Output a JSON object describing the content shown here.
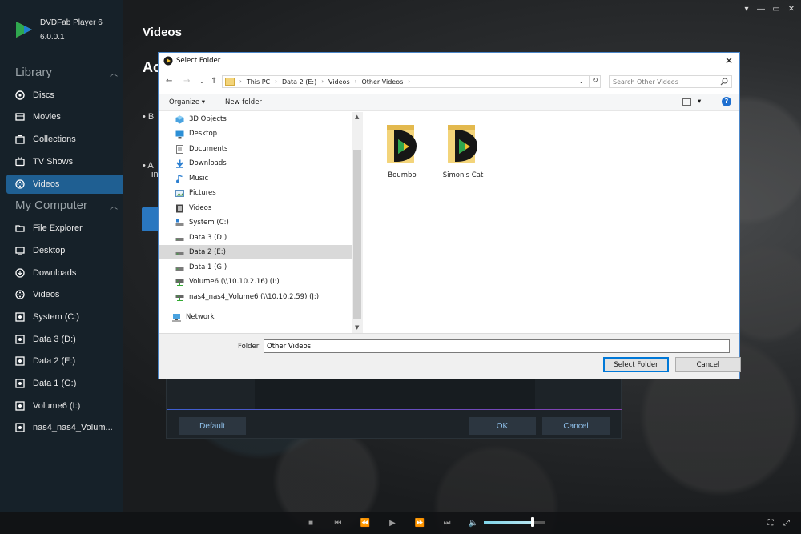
{
  "app": {
    "name": "DVDFab Player 6",
    "version": "6.0.0.1"
  },
  "sidebar": {
    "library_title": "Library",
    "library_items": [
      {
        "label": "Discs",
        "icon": "disc-icon"
      },
      {
        "label": "Movies",
        "icon": "film-icon"
      },
      {
        "label": "Collections",
        "icon": "collection-icon"
      },
      {
        "label": "TV Shows",
        "icon": "tv-icon"
      },
      {
        "label": "Videos",
        "icon": "video-reel-icon",
        "active": true
      }
    ],
    "computer_title": "My Computer",
    "computer_items": [
      {
        "label": "File Explorer",
        "icon": "folder-icon"
      },
      {
        "label": "Desktop",
        "icon": "monitor-icon"
      },
      {
        "label": "Downloads",
        "icon": "download-icon"
      },
      {
        "label": "Videos",
        "icon": "video-reel-icon"
      },
      {
        "label": "System (C:)",
        "icon": "drive-icon"
      },
      {
        "label": "Data 3 (D:)",
        "icon": "drive-icon"
      },
      {
        "label": "Data 2 (E:)",
        "icon": "drive-icon"
      },
      {
        "label": "Data 1 (G:)",
        "icon": "drive-icon"
      },
      {
        "label": "Volume6 (I:)",
        "icon": "drive-icon"
      },
      {
        "label": "nas4_nas4_Volum...",
        "icon": "drive-icon"
      }
    ]
  },
  "main": {
    "title": "Videos",
    "subtitle_partial": "Ac",
    "bullet1_partial": "B",
    "bullet2_line1_partial": "A",
    "bullet2_line2_partial": "in"
  },
  "settings_panel": {
    "default_label": "Default",
    "ok_label": "OK",
    "cancel_label": "Cancel"
  },
  "dialog": {
    "title": "Select Folder",
    "breadcrumb": [
      "This PC",
      "Data 2 (E:)",
      "Videos",
      "Other Videos"
    ],
    "search_placeholder": "Search Other Videos",
    "toolbar": {
      "organize": "Organize",
      "new_folder": "New folder"
    },
    "tree": [
      {
        "label": "3D Objects",
        "icon": "cube-icon"
      },
      {
        "label": "Desktop",
        "icon": "desktop-icon"
      },
      {
        "label": "Documents",
        "icon": "document-icon"
      },
      {
        "label": "Downloads",
        "icon": "download-arrow-icon"
      },
      {
        "label": "Music",
        "icon": "music-note-icon"
      },
      {
        "label": "Pictures",
        "icon": "picture-icon"
      },
      {
        "label": "Videos",
        "icon": "film-strip-icon"
      },
      {
        "label": "System (C:)",
        "icon": "system-drive-icon"
      },
      {
        "label": "Data 3 (D:)",
        "icon": "drive-icon"
      },
      {
        "label": "Data 2 (E:)",
        "icon": "drive-icon",
        "selected": true
      },
      {
        "label": "Data 1 (G:)",
        "icon": "drive-icon"
      },
      {
        "label": "Volume6 (\\\\10.10.2.16) (I:)",
        "icon": "network-drive-icon"
      },
      {
        "label": "nas4_nas4_Volume6 (\\\\10.10.2.59) (J:)",
        "icon": "network-drive-icon"
      }
    ],
    "network_label": "Network",
    "files": [
      {
        "name": "Boumbo",
        "icon": "dvdfab-folder-icon"
      },
      {
        "name": "Simon's Cat",
        "icon": "dvdfab-folder-icon"
      }
    ],
    "folder_label": "Folder:",
    "folder_value": "Other Videos",
    "select_button": "Select Folder",
    "cancel_button": "Cancel"
  },
  "colors": {
    "sidebar_active": "#1f5f92",
    "dialog_border": "#4b86c8",
    "primary_button_border": "#0078d7",
    "volume_fill": "#7fd4e8"
  },
  "player": {
    "volume": 0.8
  }
}
